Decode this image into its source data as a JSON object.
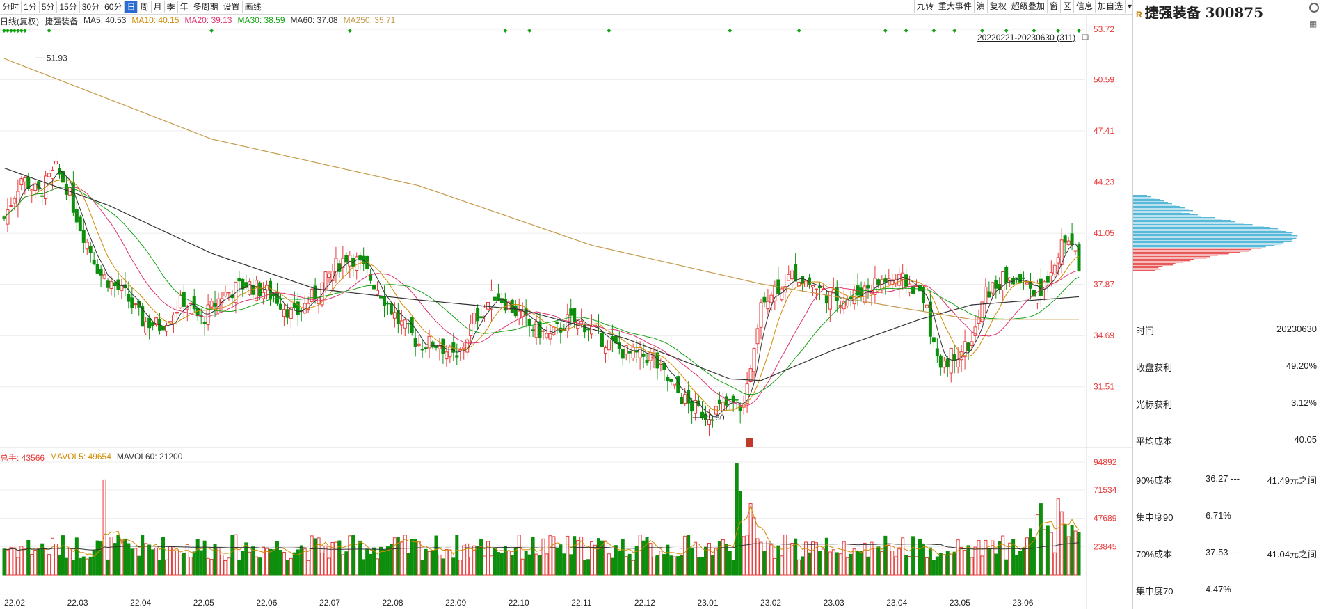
{
  "toolbar": {
    "periods": [
      "分时",
      "1分",
      "5分",
      "15分",
      "30分",
      "60分",
      "日",
      "周",
      "月",
      "季",
      "年",
      "多周期",
      "设置",
      "画线"
    ],
    "active": "日",
    "right_items": [
      "九转",
      "重大事件",
      "演",
      "复权",
      "超级叠加",
      "窗",
      "区",
      "信息",
      "加自选",
      "▾"
    ]
  },
  "ma_legend": {
    "title": "日线(复权)",
    "name": "捷强装备",
    "ma5": "MA5: 40.53",
    "ma10": "MA10: 40.15",
    "ma20": "MA20: 39.13",
    "ma30": "MA30: 38.59",
    "ma60": "MA60: 37.08",
    "ma250": "MA250: 35.71"
  },
  "vol_legend": {
    "total": "总手: 43566",
    "mavol5": "MAVOL5: 49654",
    "mavol60": "MAVOL60: 21200"
  },
  "colors": {
    "up": "#e83a3a",
    "down": "#0d8f0d",
    "ma5": "#333333",
    "ma10": "#d08a00",
    "ma20": "#e0326e",
    "ma30": "#12a212",
    "ma60": "#333333",
    "ma250": "#c49a4a",
    "grid": "#ececec",
    "nine_green": "#22c84a",
    "nine_magenta": "#d020d0",
    "nine_cyan": "#20a8c8"
  },
  "chart_data": {
    "type": "candlestick",
    "date_range_label": "20220221-20230630 (311)",
    "price_axis": {
      "ticks": [
        "53.72",
        "50.59",
        "47.41",
        "44.23",
        "41.05",
        "37.87",
        "34.69",
        "31.51"
      ],
      "min": 28.3,
      "max": 53.72
    },
    "volume_axis": {
      "ticks": [
        "94892",
        "71534",
        "47689",
        "23845"
      ],
      "max": 94892
    },
    "x_labels": [
      "22.02",
      "22.03",
      "22.04",
      "22.05",
      "22.06",
      "22.07",
      "22.08",
      "22.09",
      "22.10",
      "22.11",
      "22.12",
      "23.01",
      "23.02",
      "23.03",
      "23.04",
      "23.05",
      "23.06"
    ],
    "annotations": {
      "high": "51.93",
      "low": "29.60"
    },
    "anchors": [
      [
        0,
        42.0
      ],
      [
        5,
        44.5
      ],
      [
        10,
        43.5
      ],
      [
        15,
        45.0
      ],
      [
        18,
        44.0
      ],
      [
        22,
        41.5
      ],
      [
        28,
        38.5
      ],
      [
        35,
        37.2
      ],
      [
        40,
        35.6
      ],
      [
        45,
        35.3
      ],
      [
        52,
        36.9
      ],
      [
        57,
        35.6
      ],
      [
        63,
        37.2
      ],
      [
        70,
        37.9
      ],
      [
        78,
        37.2
      ],
      [
        84,
        35.9
      ],
      [
        91,
        37.5
      ],
      [
        96,
        39.0
      ],
      [
        100,
        39.8
      ],
      [
        104,
        38.8
      ],
      [
        109,
        37.4
      ],
      [
        114,
        35.6
      ],
      [
        120,
        34.2
      ],
      [
        126,
        34.2
      ],
      [
        131,
        33.1
      ],
      [
        136,
        35.7
      ],
      [
        142,
        37.3
      ],
      [
        147,
        36.4
      ],
      [
        152,
        35.3
      ],
      [
        158,
        34.6
      ],
      [
        163,
        35.6
      ],
      [
        168,
        35.4
      ],
      [
        175,
        34.2
      ],
      [
        181,
        33.5
      ],
      [
        187,
        33.4
      ],
      [
        193,
        31.6
      ],
      [
        198,
        30.4
      ],
      [
        203,
        29.8
      ],
      [
        210,
        30.4
      ],
      [
        214,
        30.3
      ],
      [
        219,
        37.0
      ],
      [
        224,
        37.8
      ],
      [
        229,
        38.5
      ],
      [
        234,
        37.8
      ],
      [
        239,
        37.1
      ],
      [
        245,
        37.0
      ],
      [
        250,
        37.8
      ],
      [
        256,
        38.2
      ],
      [
        261,
        38.0
      ],
      [
        266,
        37.2
      ],
      [
        270,
        32.9
      ],
      [
        276,
        33.7
      ],
      [
        280,
        34.2
      ],
      [
        284,
        37.3
      ],
      [
        290,
        38.3
      ],
      [
        296,
        37.9
      ],
      [
        300,
        37.4
      ],
      [
        304,
        39.5
      ],
      [
        308,
        40.8
      ],
      [
        311,
        39.0
      ]
    ],
    "ma250_anchors": [
      [
        0,
        51.9
      ],
      [
        60,
        46.9
      ],
      [
        120,
        44.0
      ],
      [
        170,
        40.3
      ],
      [
        219,
        37.9
      ],
      [
        260,
        36.4
      ],
      [
        280,
        35.7
      ],
      [
        311,
        35.7
      ]
    ],
    "ma60_anchors": [
      [
        0,
        45.1
      ],
      [
        30,
        42.8
      ],
      [
        60,
        39.8
      ],
      [
        90,
        37.6
      ],
      [
        120,
        36.9
      ],
      [
        150,
        36.3
      ],
      [
        180,
        34.5
      ],
      [
        210,
        32.0
      ],
      [
        219,
        31.9
      ],
      [
        240,
        33.8
      ],
      [
        265,
        35.7
      ],
      [
        280,
        36.6
      ],
      [
        311,
        37.1
      ]
    ],
    "volume_profile_note": "cost distribution at right edge"
  },
  "sidebar": {
    "badge": "R",
    "title": "捷强装备 300875",
    "rows": [
      {
        "label": "时间",
        "mid": "",
        "value": "20230630"
      },
      {
        "label": "收盘获利",
        "mid": "",
        "value": "49.20%"
      },
      {
        "label": "光标获利",
        "mid": "",
        "value": "3.12%"
      },
      {
        "label": "平均成本",
        "mid": "",
        "value": "40.05"
      },
      {
        "label": "90%成本",
        "mid": "36.27 ---",
        "value": "41.49元之间"
      },
      {
        "label": "集中度90",
        "mid": "6.71%",
        "value": ""
      },
      {
        "label": "70%成本",
        "mid": "37.53 ---",
        "value": "41.04元之间"
      },
      {
        "label": "集中度70",
        "mid": "4.47%",
        "value": ""
      }
    ]
  }
}
